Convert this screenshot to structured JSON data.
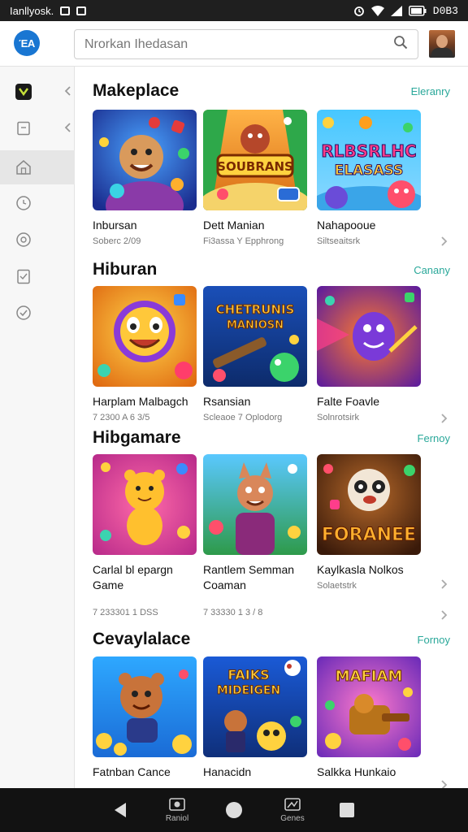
{
  "status_bar": {
    "carrier": "Ianllyosk.",
    "time": "D0B3"
  },
  "header": {
    "logo_text": "ΈΑ",
    "search_placeholder": "Nrorkan Ihedasan"
  },
  "sidebar": {
    "items": [
      {
        "icon": "app-icon",
        "active": false,
        "chevron": true
      },
      {
        "icon": "document-icon",
        "active": false,
        "chevron": true
      },
      {
        "icon": "home-icon",
        "active": true,
        "chevron": false
      },
      {
        "icon": "clock-icon",
        "active": false,
        "chevron": false
      },
      {
        "icon": "settings-icon",
        "active": false,
        "chevron": false
      },
      {
        "icon": "clipboard-icon",
        "active": false,
        "chevron": false
      },
      {
        "icon": "check-icon",
        "active": false,
        "chevron": false
      }
    ]
  },
  "sections": [
    {
      "title": "Makeplace",
      "link": "Eleranry",
      "cards": [
        {
          "title": "Inbursan",
          "sub": "Soberc 2/09"
        },
        {
          "title": "Dett Manian",
          "sub": "Fi3assa Y Epphrong"
        },
        {
          "title": "Nahapooue",
          "sub": "Siltseaitsrk"
        }
      ]
    },
    {
      "title": "Hiburan",
      "link": "Canany",
      "cards": [
        {
          "title": "Harplam Malbagch",
          "sub": "7 2300 A 6 3/5"
        },
        {
          "title": "Rsansian",
          "sub": "Scleaoe 7 Oplodorg"
        },
        {
          "title": "Falte Foavle",
          "sub": "Solnrotsirk"
        }
      ]
    },
    {
      "title": "Hibgamare",
      "link": "Fernoy",
      "cards": [
        {
          "title": "Carlal bl epargn Game",
          "sub": "7 233301 1 DSS"
        },
        {
          "title": "Rantlem Semman Coaman",
          "sub": "7 33330 1 3 / 8"
        },
        {
          "title": "Kaylkasla Nolkos",
          "sub": "Solaetstrk"
        }
      ]
    },
    {
      "title": "Cevaylalace",
      "link": "Fornoy",
      "cards": [
        {
          "title": "Fatnban Cance",
          "sub": ""
        },
        {
          "title": "Hanacidn",
          "sub": ""
        },
        {
          "title": "Salkka Hunkaio",
          "sub": ""
        }
      ]
    }
  ],
  "thumbnails": {
    "banner_1_2": "SOUBRANS",
    "banner_1_3a": "RLBSRLHC",
    "banner_1_3b": "ELASASS",
    "banner_2_2a": "CHETRUNIS",
    "banner_2_2b": "MANIOSN",
    "banner_3_3": "FORANEE",
    "banner_4_2a": "FAIKS",
    "banner_4_2b": "MIDEIGEN",
    "banner_4_3": "MAFIAM"
  },
  "navbar": {
    "recents_label": "Raniol",
    "games_label": "Genes"
  },
  "colors": {
    "accent_link": "#2aa89a",
    "logo_blue": "#1976d2",
    "nav_bg": "#121212",
    "status_bg": "#1f1f1f"
  }
}
